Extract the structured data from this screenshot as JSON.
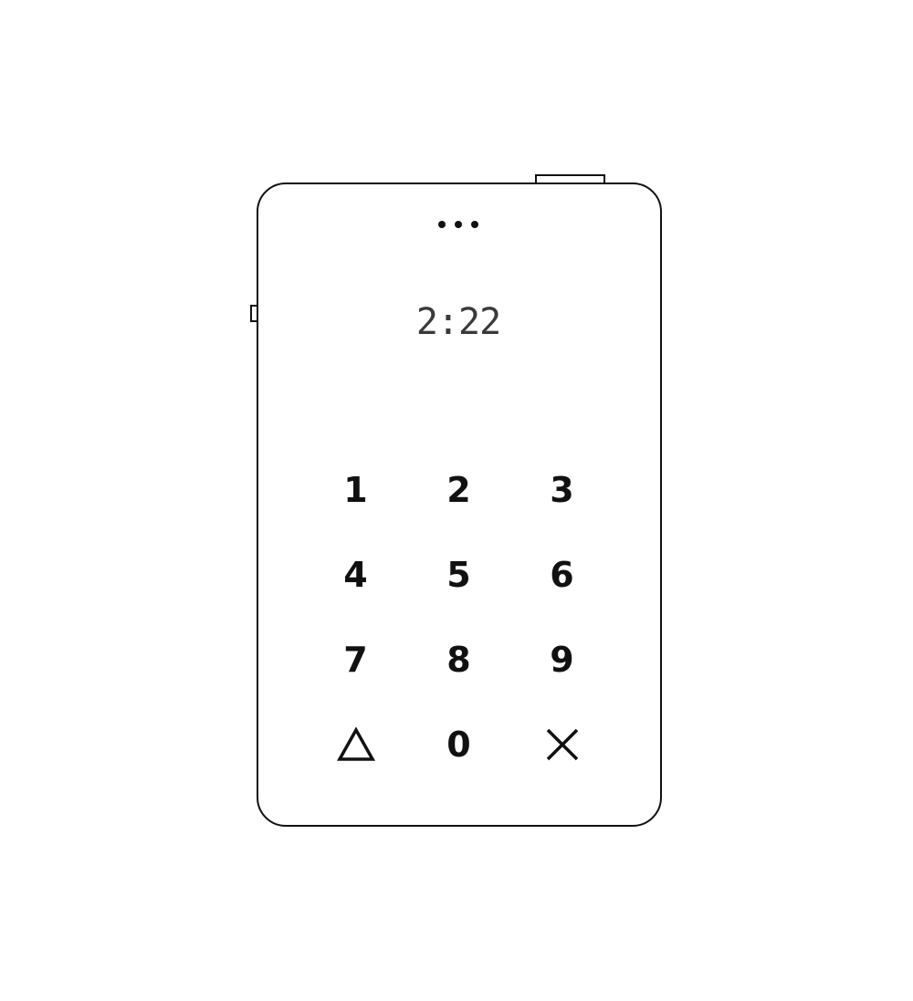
{
  "status": {
    "time": "2:22"
  },
  "keypad": {
    "keys": [
      {
        "label": "1"
      },
      {
        "label": "2"
      },
      {
        "label": "3"
      },
      {
        "label": "4"
      },
      {
        "label": "5"
      },
      {
        "label": "6"
      },
      {
        "label": "7"
      },
      {
        "label": "8"
      },
      {
        "label": "9"
      },
      {
        "label": "",
        "icon": "triangle-icon"
      },
      {
        "label": "0"
      },
      {
        "label": "",
        "icon": "close-icon"
      }
    ]
  },
  "icons": {
    "menu": "more-dots-icon"
  },
  "colors": {
    "outline": "#111111",
    "clock_text": "#3a3a3a",
    "background": "#ffffff"
  }
}
